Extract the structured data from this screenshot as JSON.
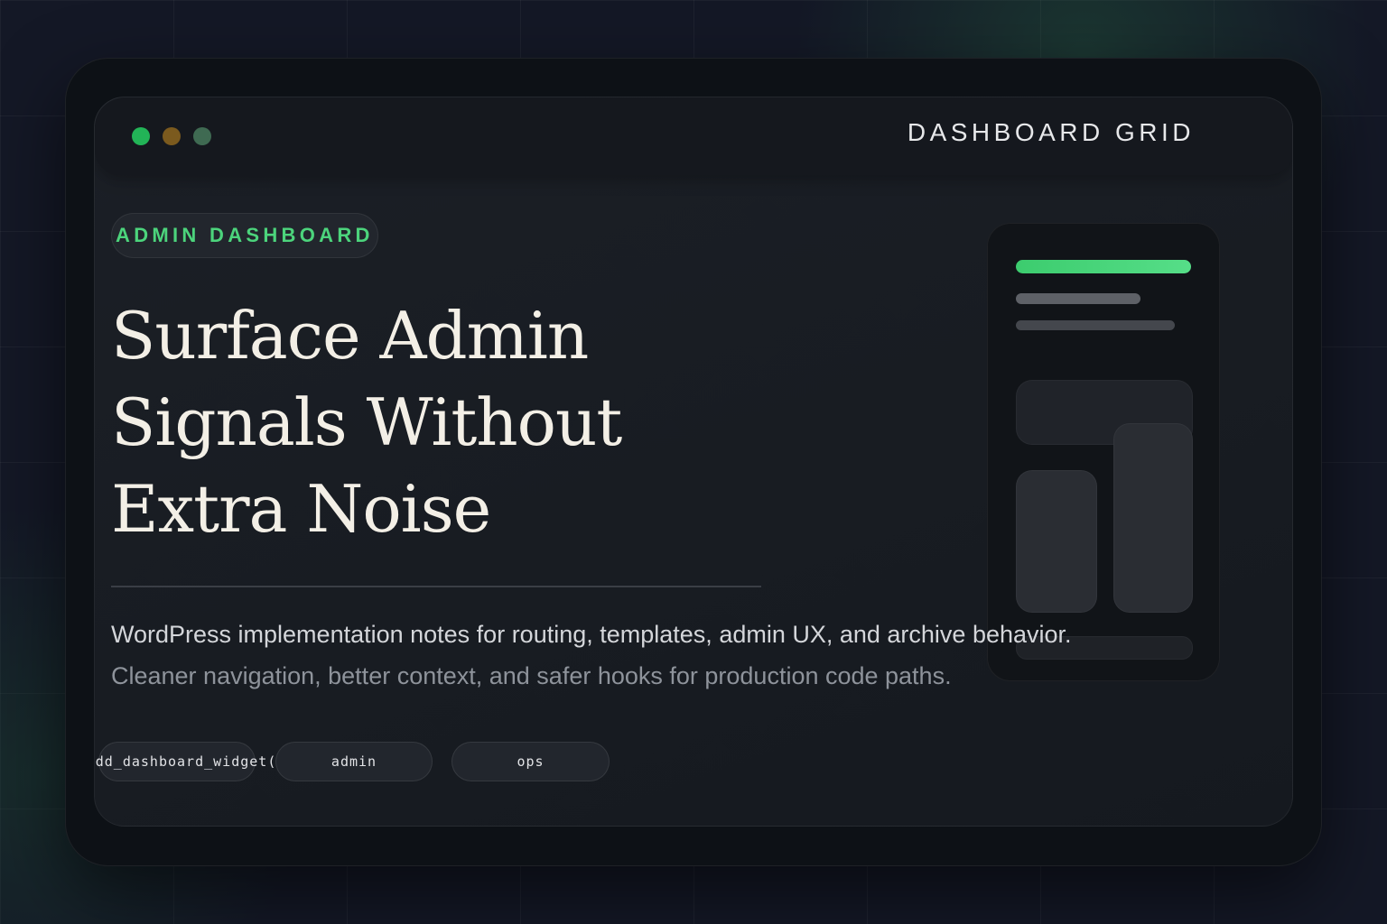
{
  "window": {
    "title": "DASHBOARD GRID"
  },
  "hero": {
    "badge": "ADMIN DASHBOARD",
    "headline_lines": [
      "Surface Admin",
      "Signals Without",
      "Extra Noise"
    ],
    "description": "WordPress implementation notes for routing, templates, admin UX, and archive behavior.",
    "subdescription": "Cleaner navigation, better context, and safer hooks for production code paths."
  },
  "tags": [
    "wp_add_dashboard_widget()",
    "admin",
    "ops"
  ],
  "colors": {
    "accent": "#4cd47c",
    "background": "#141826",
    "headline": "#f3efe6",
    "dot_green": "#22b457",
    "dot_amber": "#7b5a1e",
    "dot_teal": "#3f6a52"
  }
}
